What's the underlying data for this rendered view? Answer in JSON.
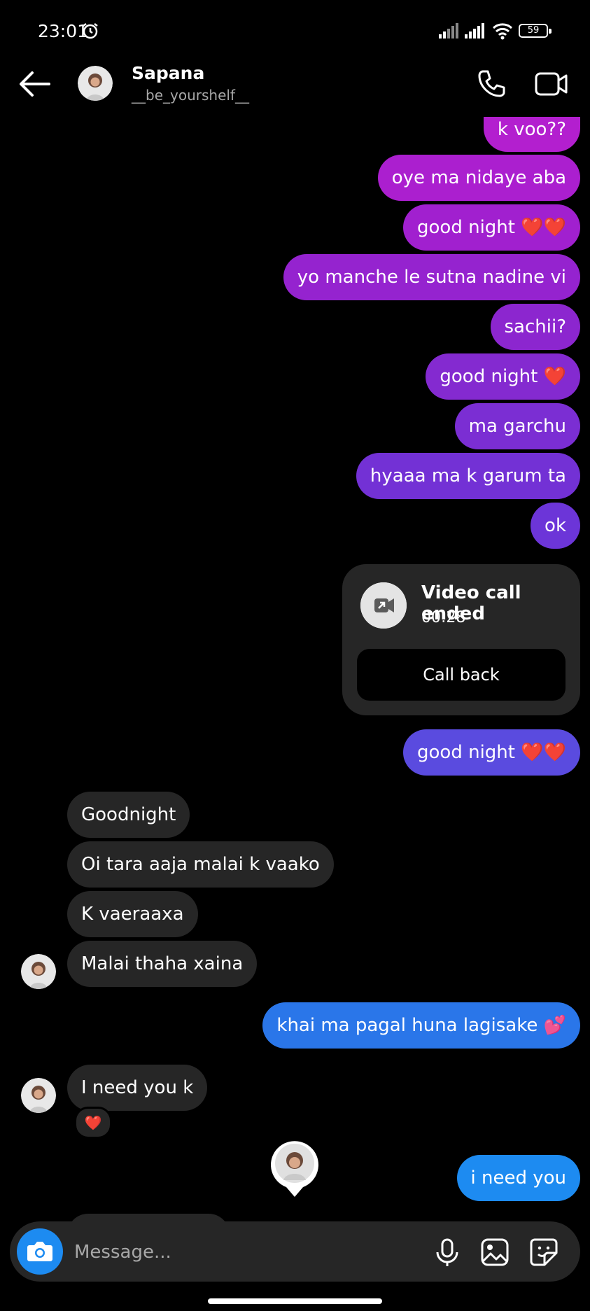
{
  "status_bar": {
    "time": "23:01",
    "battery": "59"
  },
  "header": {
    "name": "Sapana",
    "handle": "__be_yourshelf__"
  },
  "messages": {
    "m1": "k voo??",
    "m2": "oye ma nidaye aba",
    "m3": "good night ❤️❤️",
    "m4": "yo manche le sutna nadine vi",
    "m5": "sachii?",
    "m6": "good night ❤️",
    "m7": "ma garchu",
    "m8": "hyaaa ma k garum ta",
    "m9": "ok",
    "m10": "good night ❤️❤️",
    "i1": "Goodnight",
    "i2": "Oi tara aaja malai k vaako",
    "i3": "K vaeraaxa",
    "i4": "Malai thaha xaina",
    "m11": "khai ma pagal huna lagisake 💕",
    "i5": "I need you k",
    "m12": "i need you"
  },
  "call_card": {
    "title": "Video call ended",
    "duration": "00:28",
    "action": "Call back"
  },
  "reaction": "❤️",
  "composer": {
    "placeholder": "Message..."
  },
  "colors": {
    "bubble_incoming": "#262626",
    "grad_top": "#b51ed0",
    "grad_mid": "#6b35d8",
    "grad_bottom": "#1d8bf1"
  },
  "icons": [
    "back-arrow-icon",
    "phone-icon",
    "video-camera-icon",
    "camera-icon",
    "microphone-icon",
    "gallery-icon",
    "sticker-icon",
    "alarm-icon",
    "signal-icon",
    "wifi-icon",
    "battery-icon"
  ]
}
